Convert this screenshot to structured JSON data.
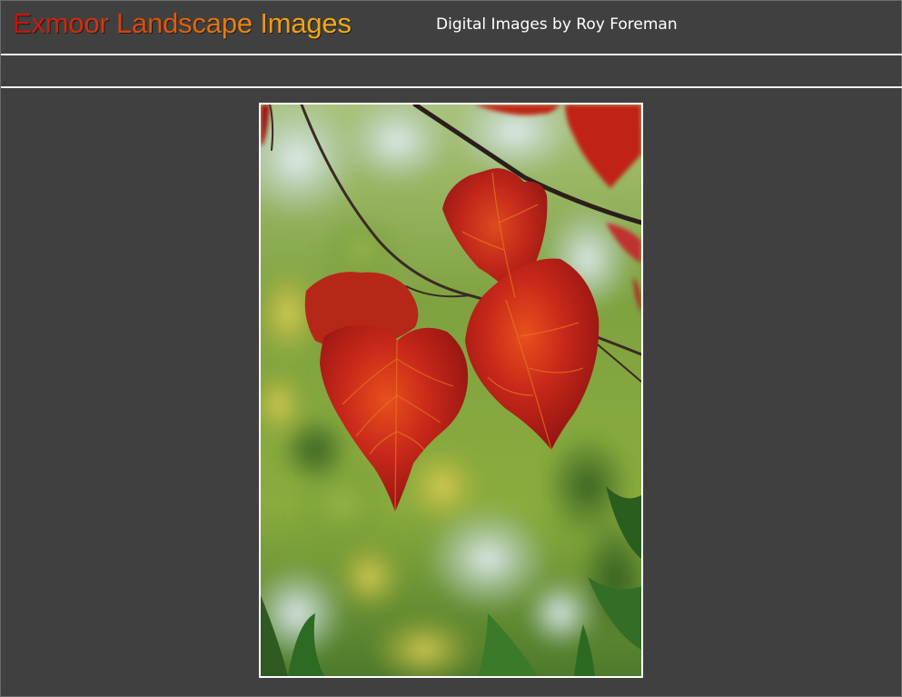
{
  "header": {
    "site_title": "Exmoor Landscape Images",
    "tagline": "Digital Images by Roy Foreman"
  },
  "photo": {
    "subject": "red-autumn-leaves-photo"
  },
  "colors": {
    "background": "#404040",
    "rule": "#f2f2f2",
    "title_gradient_start": "#c4120e",
    "title_gradient_end": "#f4b012",
    "tagline": "#ffffff"
  }
}
